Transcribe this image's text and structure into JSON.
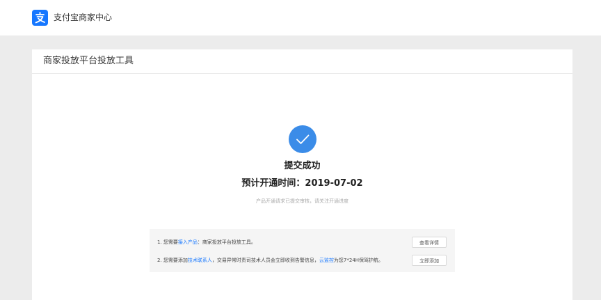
{
  "header": {
    "brand": "支付宝商家中心",
    "logo_icon": "alipay-logo-icon"
  },
  "card": {
    "title": "商家投放平台投放工具"
  },
  "result": {
    "icon": "check-circle-icon",
    "title": "提交成功",
    "time": "预计开通时间：2019-07-02",
    "desc": "产品开通请求已提交审核，请关注开通进度"
  },
  "steps": [
    {
      "prefix": "1. 您需要",
      "link": "接入产品",
      "suffix": "：商家投放平台投放工具。",
      "button": "查看详情"
    },
    {
      "prefix": "2. 您需要添加",
      "link": "技术联系人",
      "middle": "，交易异常时责司技术人员会立即收到告警信息，",
      "link2": "云监控",
      "suffix": "为您7*24H保驾护航。",
      "button": "立即添加"
    }
  ],
  "colors": {
    "accent": "#1677ff",
    "success": "#3b8ce8",
    "background": "#ececec"
  }
}
